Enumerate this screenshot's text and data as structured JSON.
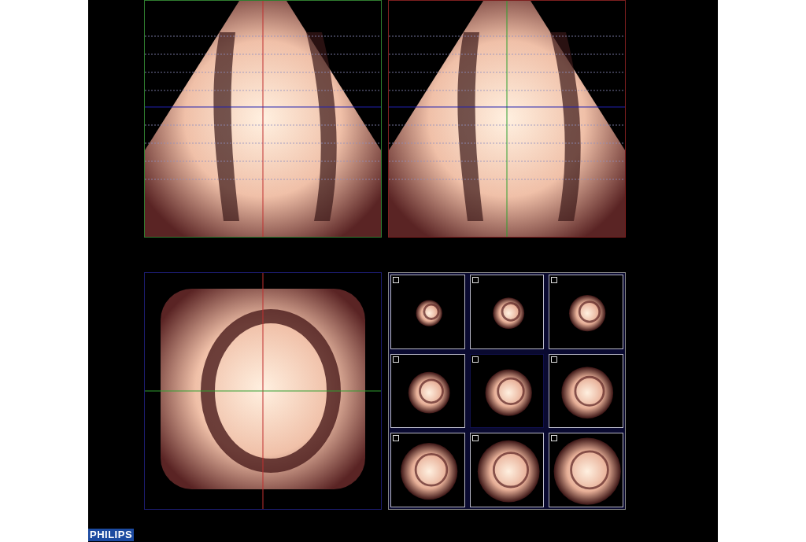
{
  "views": [
    {
      "kind": "sector",
      "color": "#2f7d2f"
    },
    {
      "kind": "sector",
      "color": "#7d1f1f"
    },
    {
      "kind": "short-axis",
      "color": "#1c1c6e"
    }
  ],
  "slices": [
    {
      "selected": false,
      "checked": false
    },
    {
      "selected": false,
      "checked": false
    },
    {
      "selected": false,
      "checked": false
    },
    {
      "selected": false,
      "checked": false
    },
    {
      "selected": true,
      "checked": false
    },
    {
      "selected": false,
      "checked": false
    },
    {
      "selected": false,
      "checked": false
    },
    {
      "selected": false,
      "checked": false
    },
    {
      "selected": false,
      "checked": false
    }
  ],
  "logo": {
    "text": "PHILIPS"
  }
}
